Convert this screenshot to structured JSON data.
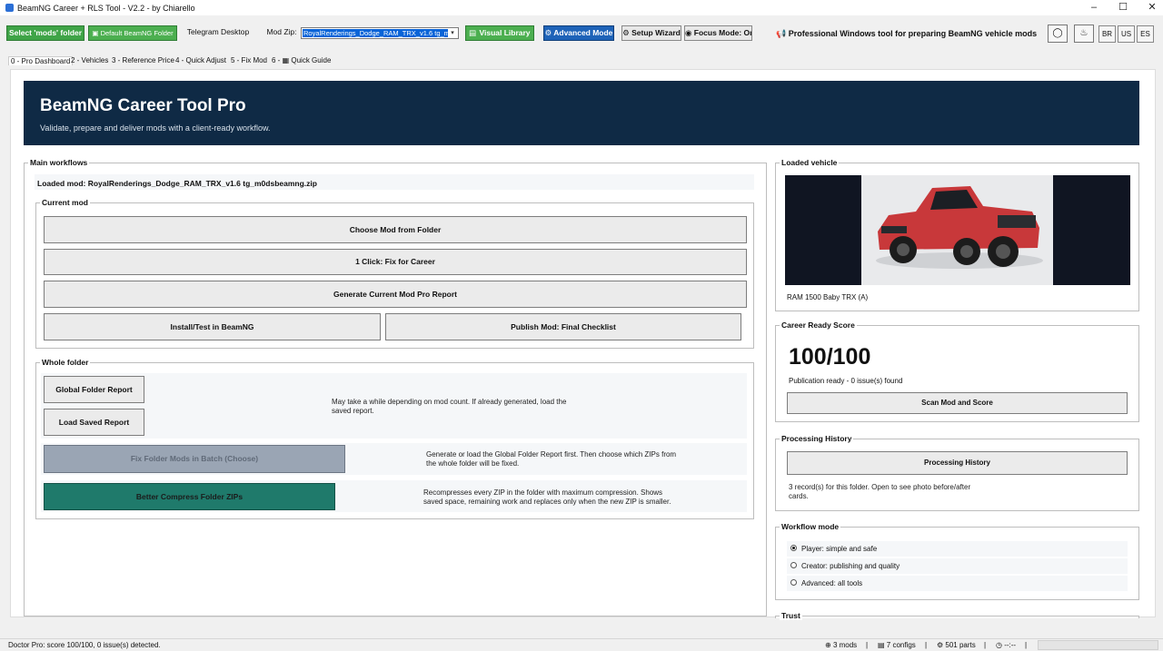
{
  "window": {
    "title": "BeamNG Career + RLS Tool - V2.2 - by Chiarello",
    "min": "–",
    "max": "☐",
    "close": "✕"
  },
  "toolbar": {
    "select_mods_folder": "Select 'mods' folder",
    "default_folder": "Default BeamNG Folder",
    "telegram": "Telegram Desktop",
    "mod_zip_label": "Mod Zip:",
    "mod_zip_value": "RoyalRenderings_Dodge_RAM_TRX_v1.6 tg_m",
    "visual_library": "Visual Library",
    "advanced_mode": "Advanced Mode",
    "setup_wizard": "Setup Wizard",
    "focus_mode": "Focus Mode: On",
    "tagline": "Professional Windows tool for preparing BeamNG vehicle mods",
    "lang_br": "BR",
    "lang_us": "US",
    "lang_es": "ES",
    "icon_chat": "chat-icon",
    "icon_donate": "donate-icon"
  },
  "tabs": [
    "0 - Pro Dashboard",
    "2 - Vehicles",
    "3 - Reference Price",
    "4 - Quick Adjust",
    "5 - Fix Mod",
    "6 -",
    "Quick Guide"
  ],
  "hero": {
    "title": "BeamNG Career Tool Pro",
    "subtitle": "Validate, prepare and deliver mods with a client-ready workflow."
  },
  "main_workflows": {
    "legend": "Main workflows",
    "loaded_mod": "Loaded mod: RoyalRenderings_Dodge_RAM_TRX_v1.6 tg_m0dsbeamng.zip",
    "current_mod": {
      "legend": "Current mod",
      "choose": "Choose Mod from Folder",
      "fix_career": "1 Click: Fix for Career",
      "report": "Generate Current Mod Pro Report",
      "install": "Install/Test in BeamNG",
      "publish": "Publish Mod: Final Checklist"
    },
    "whole_folder": {
      "legend": "Whole folder",
      "global_report": "Global Folder Report",
      "load_saved": "Load Saved Report",
      "report_note": "May take a while depending on mod count. If already generated, load the saved report.",
      "fix_batch": "Fix Folder Mods in Batch (Choose)",
      "fix_batch_note": "Generate or load the Global Folder Report first. Then choose which ZIPs from the whole folder will be fixed.",
      "compress": "Better Compress Folder ZIPs",
      "compress_note": "Recompresses every ZIP in the folder with maximum compression. Shows saved space, remaining work and replaces only when the new ZIP is smaller."
    }
  },
  "loaded_vehicle": {
    "legend": "Loaded vehicle",
    "name": "RAM 1500 Baby TRX (A)"
  },
  "career_score": {
    "legend": "Career Ready Score",
    "score": "100/100",
    "status": "Publication ready - 0 issue(s) found",
    "scan": "Scan Mod and Score"
  },
  "history": {
    "legend": "Processing History",
    "button": "Processing History",
    "note": "3 record(s) for this folder. Open to see photo before/after cards."
  },
  "workflow_mode": {
    "legend": "Workflow mode",
    "options": [
      "Player: simple and safe",
      "Creator: publishing and quality",
      "Advanced: all tools"
    ]
  },
  "trust": {
    "legend": "Trust"
  },
  "status": {
    "left": "Doctor Pro: score 100/100, 0 issue(s) detected.",
    "mods": "3 mods",
    "configs": "7 configs",
    "parts": "501 parts",
    "clock": "--:--",
    "sep": "|"
  },
  "colors": {
    "hero_bg": "#0f2a45",
    "green": "#3fa447",
    "blue": "#1e63b8",
    "teal": "#1f7a6b",
    "disabled": "#9aa5b4"
  }
}
